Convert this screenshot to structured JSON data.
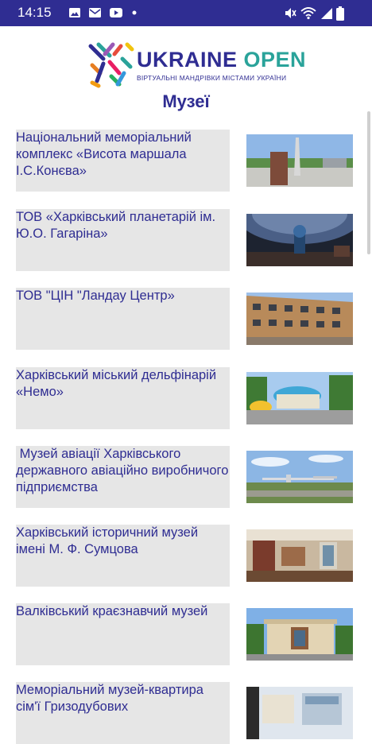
{
  "status_bar": {
    "time": "14:15",
    "left_icons": [
      "image-icon",
      "mail-icon",
      "youtube-icon",
      "dot-icon"
    ],
    "right_icons": [
      "mute-icon",
      "wifi-icon",
      "signal-icon",
      "battery-icon"
    ]
  },
  "header": {
    "logo_word_a": "UKRAINE ",
    "logo_word_b": "OPEN",
    "logo_subtitle": "ВІРТУАЛЬНІ МАНДРІВКИ МІСТАМИ УКРАЇНИ",
    "title": "Музеї"
  },
  "colors": {
    "accent": "#2f2d92",
    "teal": "#2aa39a",
    "item_background": "#e6e6e6"
  },
  "museums": [
    {
      "name": "Національний меморіальний комплекс «Висота маршала І.С.Конєва»",
      "thumb": "memorial-photo"
    },
    {
      "name": "ТОВ «Харківський планетарій ім. Ю.О. Гагаріна»",
      "thumb": "planetarium-photo"
    },
    {
      "name": "ТОВ \"ЦІН \"Ландау Центр»",
      "thumb": "landau-center-photo"
    },
    {
      "name": "Харківський міський дельфінарій «Немо»",
      "thumb": "dolphinarium-photo"
    },
    {
      "name": " Музей авіації Харківського державного авіаційно виробничого підприємства",
      "thumb": "aviation-museum-photo"
    },
    {
      "name": "Харківський історичний музей імені М. Ф. Сумцова",
      "thumb": "historical-museum-photo"
    },
    {
      "name": "Валківський краєзнавчий музей",
      "thumb": "valky-museum-photo"
    },
    {
      "name": "Меморіальний музей-квартира сім'ї Гризодубових",
      "thumb": "apartment-museum-photo"
    }
  ]
}
